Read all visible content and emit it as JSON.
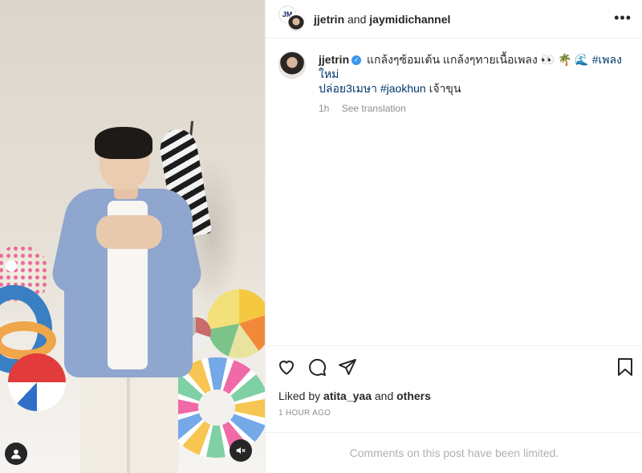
{
  "post": {
    "header": {
      "author": "jjetrin",
      "joiner": "and",
      "coauthor": "jaymidichannel",
      "more_icon": "more-horizontal-icon"
    },
    "caption": {
      "username": "jjetrin",
      "verified": true,
      "text_part1": "แกล้งๆซ้อมเต้น แกล้งๆทายเนื้อเพลง",
      "emojis": "👀 🌴 🌊",
      "hashtag1": "#เพลงใหม่",
      "hashtag1_cont": "ปล่อย3เมษา",
      "hashtag2": "#jaokhun",
      "text_part2": "เจ้าขุน",
      "age": "1h",
      "see_translation": "See translation"
    },
    "actions": {
      "like_icon": "heart-icon",
      "comment_icon": "comment-icon",
      "share_icon": "send-icon",
      "save_icon": "bookmark-icon"
    },
    "likes": {
      "prefix": "Liked by",
      "user": "atita_yaa",
      "joiner": "and",
      "others": "others"
    },
    "timestamp": "1 HOUR AGO",
    "comments_notice": "Comments on this post have been limited."
  },
  "media": {
    "tagged_icon": "user-tag-icon",
    "mute_icon": "speaker-muted-icon",
    "header_logo_text": "JM"
  }
}
